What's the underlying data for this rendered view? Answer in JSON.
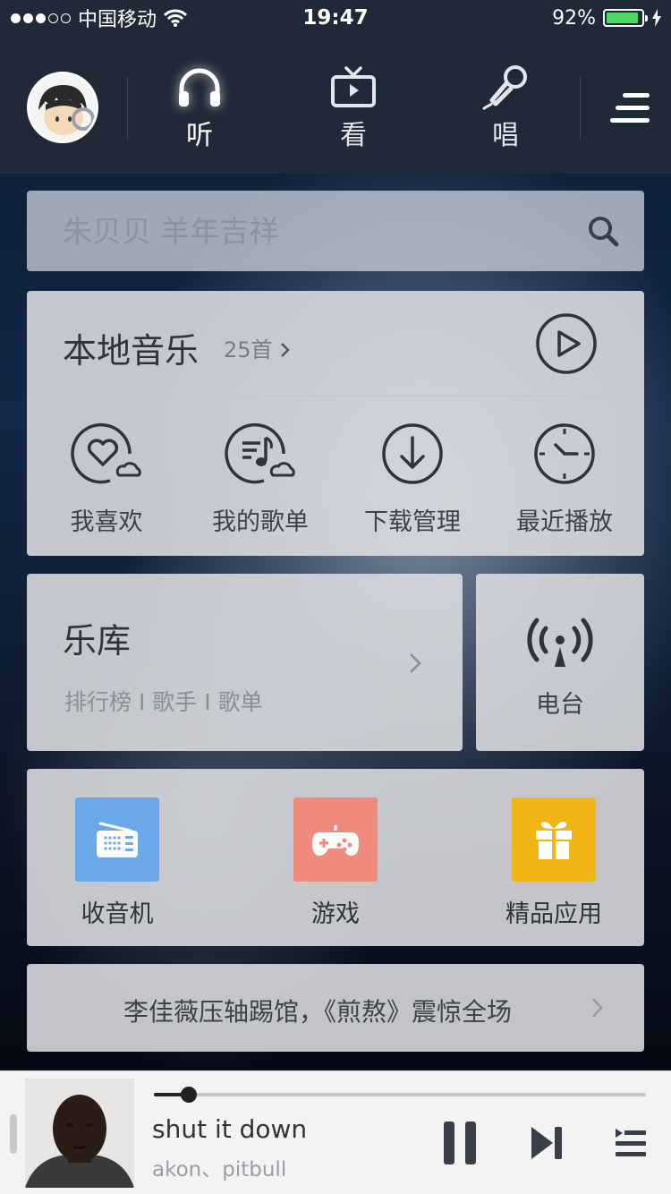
{
  "status_bar": {
    "carrier": "中国移动",
    "time": "19:47",
    "battery": "92%",
    "battery_level": 0.92,
    "signal_bars_filled": 3,
    "signal_bars_total": 5
  },
  "nav": {
    "tabs": [
      {
        "label": "听",
        "icon": "headphones-icon",
        "active": true
      },
      {
        "label": "看",
        "icon": "tv-icon",
        "active": false
      },
      {
        "label": "唱",
        "icon": "microphone-icon",
        "active": false
      }
    ]
  },
  "search": {
    "placeholder": "朱贝贝 羊年吉祥"
  },
  "local_music": {
    "title": "本地音乐",
    "count": "25首",
    "items": [
      {
        "label": "我喜欢",
        "icon": "heart-cloud-icon"
      },
      {
        "label": "我的歌单",
        "icon": "playlist-cloud-icon"
      },
      {
        "label": "下载管理",
        "icon": "download-icon"
      },
      {
        "label": "最近播放",
        "icon": "clock-icon"
      }
    ]
  },
  "library": {
    "title": "乐库",
    "sub": "排行榜 I 歌手 I 歌单"
  },
  "radio": {
    "label": "电台",
    "icon": "broadcast-icon"
  },
  "apps": [
    {
      "label": "收音机",
      "icon": "radio-icon",
      "color": "#6aa8ea"
    },
    {
      "label": "游戏",
      "icon": "gamepad-icon",
      "color": "#ef8a7c"
    },
    {
      "label": "精品应用",
      "icon": "gift-icon",
      "color": "#f2b614"
    }
  ],
  "news": {
    "text": "李佳薇压轴踢馆，《煎熬》震惊全场"
  },
  "player": {
    "song": "shut it down",
    "artist": "akon、pitbull",
    "progress": 0.07
  }
}
